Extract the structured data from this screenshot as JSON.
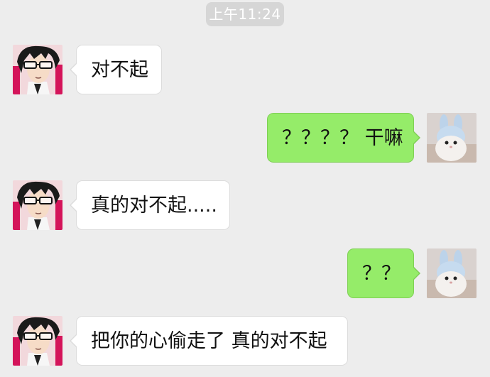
{
  "chat": {
    "timestamp": "上午11:24",
    "messages": [
      {
        "direction": "incoming",
        "avatar": "anime-glasses-avatar",
        "text": "对不起"
      },
      {
        "direction": "outgoing",
        "avatar": "bunny-hat-cat-avatar",
        "text": "？？？？ 干嘛"
      },
      {
        "direction": "incoming",
        "avatar": "anime-glasses-avatar",
        "text": "真的对不起....."
      },
      {
        "direction": "outgoing",
        "avatar": "bunny-hat-cat-avatar",
        "text": "？？"
      },
      {
        "direction": "incoming",
        "avatar": "anime-glasses-avatar",
        "text": "把你的心偷走了 真的对不起"
      }
    ]
  },
  "colors": {
    "background": "#ededed",
    "incoming_bubble": "#ffffff",
    "outgoing_bubble": "#95ec69",
    "timestamp_bg": "#d6d6d6"
  }
}
